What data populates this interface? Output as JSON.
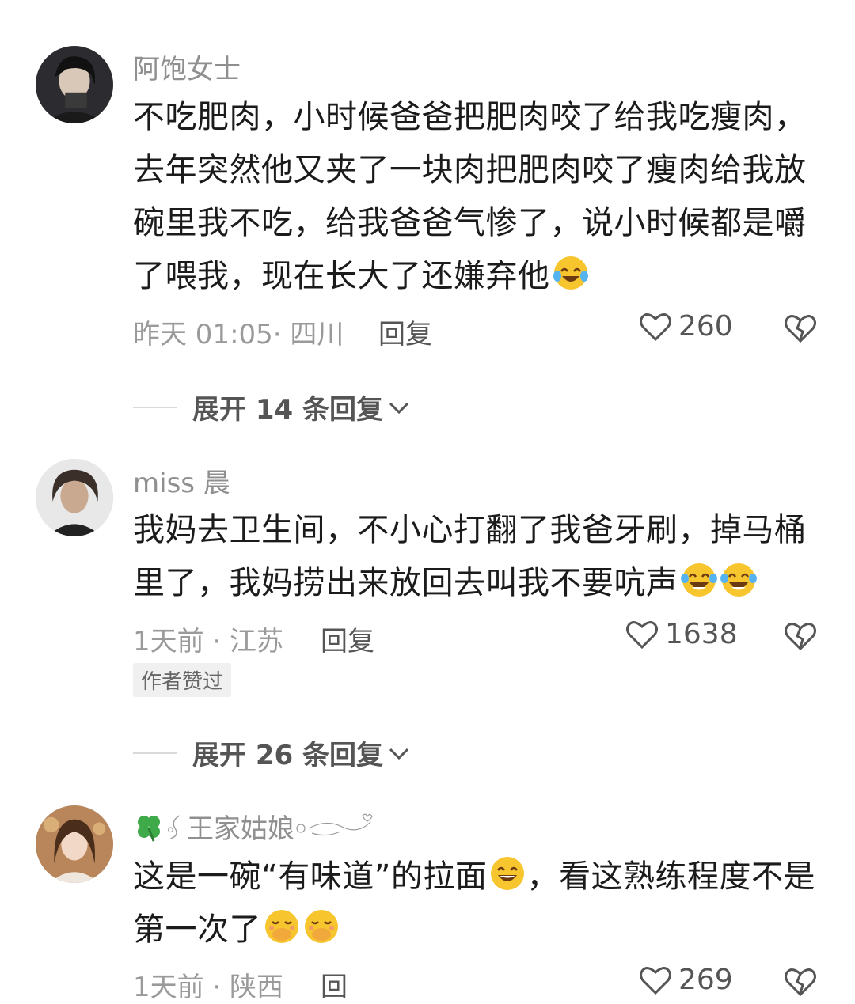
{
  "comments": [
    {
      "username": "阿饱女士",
      "text": "不吃肥肉，小时候爸爸把肥肉咬了给我吃瘦肉，去年突然他又夹了一块肉把肥肉咬了瘦肉给我放碗里我不吃，给我爸爸气惨了，说小时候都是嚼了喂我，现在长大了还嫌弃他",
      "emojis": [
        "crying-laughing-emoji"
      ],
      "meta": "昨天 01:05· 四川",
      "reply_label": "回复",
      "likes": "260",
      "expand_label": "展开 14 条回复"
    },
    {
      "username": "miss 晨",
      "text": "我妈去卫生间，不小心打翻了我爸牙刷，掉马桶里了，我妈捞出来放回去叫我不要吭声",
      "emojis": [
        "tears-of-joy-emoji",
        "tears-of-joy-emoji"
      ],
      "meta": "1天前 · 江苏",
      "reply_label": "回复",
      "likes": "1638",
      "badge": "作者赞过",
      "expand_label": "展开 26 条回复"
    },
    {
      "username": "王家姑娘",
      "text_part1": "这是一碗“有味道”的拉面",
      "text_part2": "，看这熟练程度不是第一次了",
      "emojis": [
        "grinning-emoji",
        "hand-over-mouth-emoji",
        "hand-over-mouth-emoji"
      ],
      "meta": "1天前 · 陕西",
      "reply_label": "回",
      "likes": "269"
    }
  ],
  "icons": {
    "like": "heart-outline-icon",
    "dislike": "broken-heart-icon",
    "expand": "chevron-down-icon",
    "clover": "four-leaf-clover-icon"
  },
  "colors": {
    "text": "#1b1b1b",
    "meta": "#9a9a9a",
    "badge_bg": "#f0f0f0",
    "emoji": "#f7c52d"
  }
}
